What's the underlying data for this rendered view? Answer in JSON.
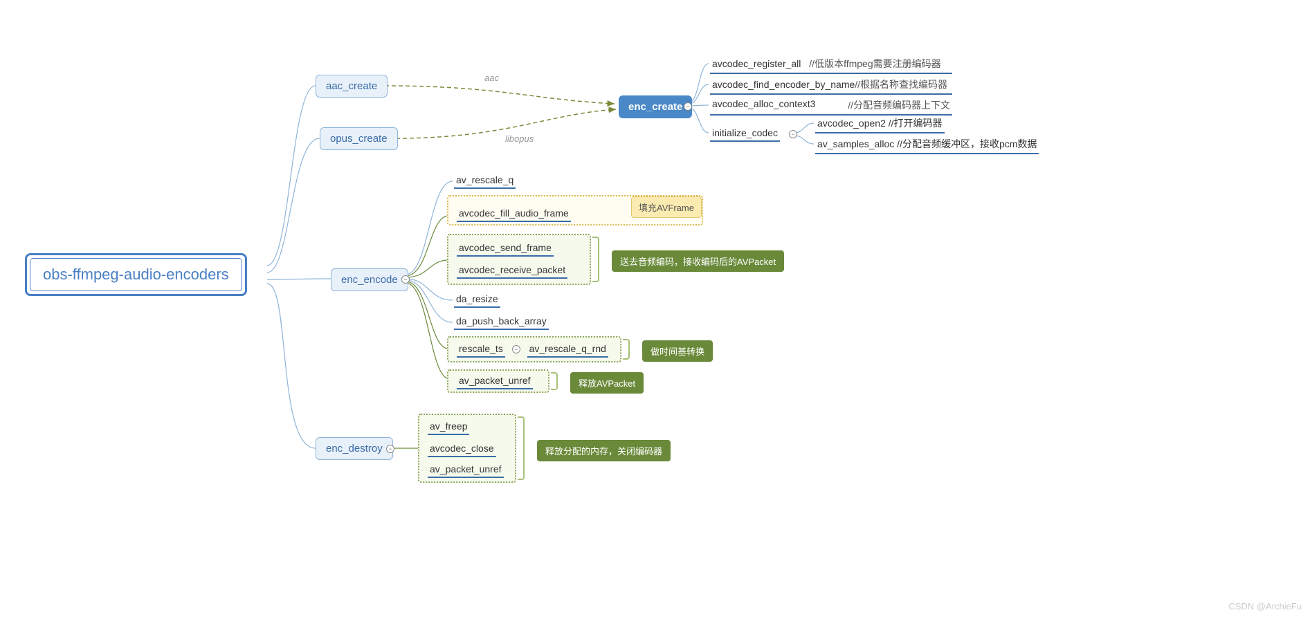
{
  "root": "obs-ffmpeg-audio-encoders",
  "children": {
    "aac_create": "aac_create",
    "opus_create": "opus_create",
    "enc_encode": "enc_encode",
    "enc_destroy": "enc_destroy"
  },
  "edge_labels": {
    "aac": "aac",
    "libopus": "libopus"
  },
  "enc_create": {
    "title": "enc_create",
    "items": {
      "reg_all": "avcodec_register_all",
      "reg_all_note": "//低版本ffmpeg需要注册编码器",
      "find": "avcodec_find_encoder_by_name",
      "find_note": "//根据名称查找编码器",
      "alloc": "avcodec_alloc_context3",
      "alloc_note": "//分配音频编码器上下文",
      "init": "initialize_codec",
      "open2": "avcodec_open2 //打开编码器",
      "samples": "av_samples_alloc //分配音频缓冲区，接收pcm数据"
    }
  },
  "enc_encode_items": {
    "rescale_q": "av_rescale_q",
    "fill_frame": "avcodec_fill_audio_frame",
    "fill_note": "填充AVFrame",
    "send": "avcodec_send_frame",
    "recv": "avcodec_receive_packet",
    "send_recv_note": "送去音频编码，接收编码后的AVPacket",
    "da_resize": "da_resize",
    "da_push": "da_push_back_array",
    "rescale_ts": "rescale_ts",
    "rescale_q_rnd": "av_rescale_q_rnd",
    "ts_note": "做时间基转换",
    "unref": "av_packet_unref",
    "unref_note": "释放AVPacket"
  },
  "enc_destroy_items": {
    "freep": "av_freep",
    "close": "avcodec_close",
    "unref": "av_packet_unref",
    "note": "释放分配的内存，关闭编码器"
  },
  "watermark": "CSDN @ArchieFu"
}
